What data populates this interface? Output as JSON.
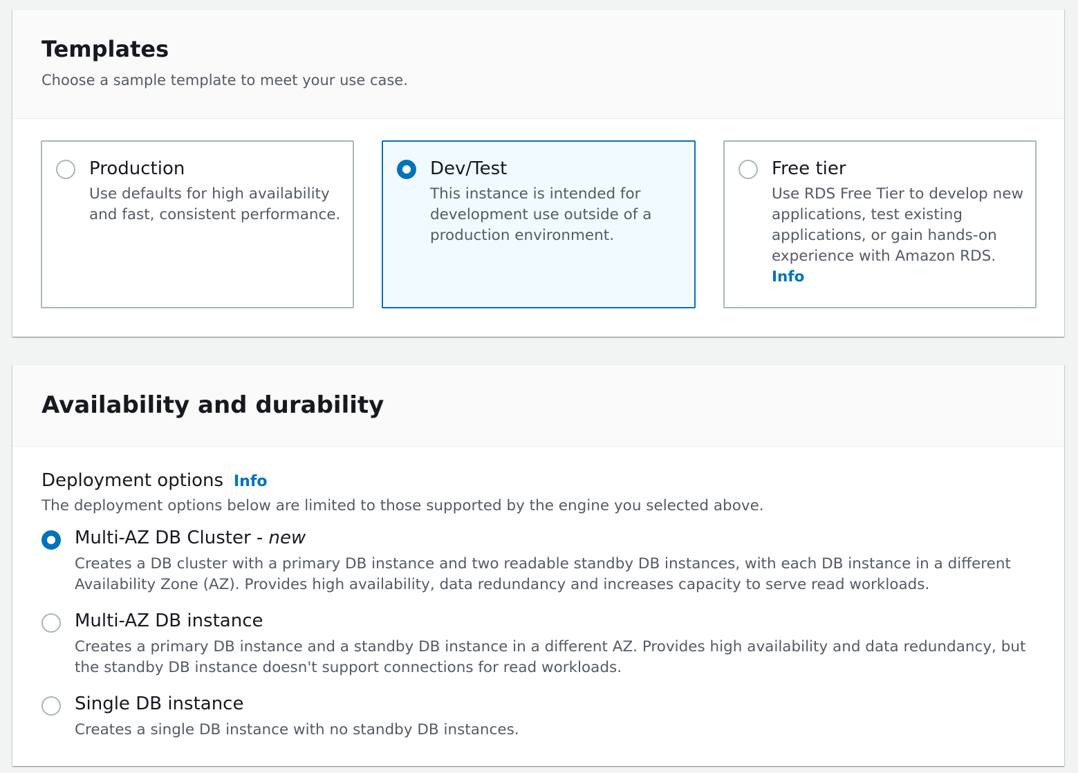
{
  "templates": {
    "title": "Templates",
    "description": "Choose a sample template to meet your use case.",
    "options": [
      {
        "title": "Production",
        "description": "Use defaults for high availability and fast, consistent performance.",
        "selected": false
      },
      {
        "title": "Dev/Test",
        "description": "This instance is intended for development use outside of a production environment.",
        "selected": true
      },
      {
        "title": "Free tier",
        "description": "Use RDS Free Tier to develop new applications, test existing applications, or gain hands-on experience with Amazon RDS.",
        "info_label": "Info",
        "selected": false
      }
    ]
  },
  "availability": {
    "title": "Availability and durability",
    "deployment": {
      "label": "Deployment options",
      "info_label": "Info",
      "description": "The deployment options below are limited to those supported by the engine you selected above.",
      "options": [
        {
          "title": "Multi-AZ DB Cluster - ",
          "title_tag": "new",
          "description": "Creates a DB cluster with a primary DB instance and two readable standby DB instances, with each DB instance in a different Availability Zone (AZ). Provides high availability, data redundancy and increases capacity to serve read workloads.",
          "selected": true
        },
        {
          "title": "Multi-AZ DB instance",
          "description": "Creates a primary DB instance and a standby DB instance in a different AZ. Provides high availability and data redundancy, but the standby DB instance doesn't support connections for read workloads.",
          "selected": false
        },
        {
          "title": "Single DB instance",
          "description": "Creates a single DB instance with no standby DB instances.",
          "selected": false
        }
      ]
    }
  },
  "colors": {
    "accent": "#0073bb",
    "selected_tile_bg": "#f1faff",
    "border": "#aab7b8",
    "secondary_text": "#545b64"
  }
}
